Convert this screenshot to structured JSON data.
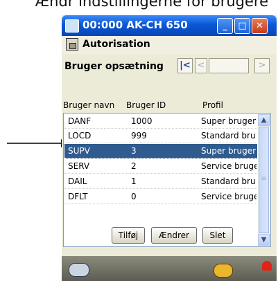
{
  "caption": "Ændr indstillingerne for brugere",
  "window": {
    "title": "00:000 AK-CH 650",
    "minimize_glyph": "_",
    "maximize_glyph": "□",
    "close_glyph": "✕"
  },
  "section": {
    "title": "Autorisation"
  },
  "user_setup": {
    "title": "Bruger opsætning",
    "nav_first": "|<",
    "nav_prev": "<",
    "nav_value": "",
    "nav_next": ">"
  },
  "columns": [
    "Bruger navn",
    "Bruger ID",
    "Profil"
  ],
  "rows": [
    {
      "name": "DANF",
      "id": "1000",
      "profile": "Super bruger"
    },
    {
      "name": "LOCD",
      "id": "999",
      "profile": "Standard bru"
    },
    {
      "name": "SUPV",
      "id": "3",
      "profile": "Super bruger"
    },
    {
      "name": "SERV",
      "id": "2",
      "profile": "Service bruge"
    },
    {
      "name": "DAIL",
      "id": "1",
      "profile": "Standard bru"
    },
    {
      "name": "DFLT",
      "id": "0",
      "profile": "Service bruge"
    }
  ],
  "selected_row_index": 2,
  "scrollbar": {
    "up": "▲",
    "down": "▼",
    "grip": "≡"
  },
  "buttons": {
    "add": "Tilføj",
    "change": "Ændrer",
    "delete": "Slet"
  },
  "icons": {
    "app": "monitor-icon",
    "lock": "lock-icon",
    "status_left": "glasses-icon",
    "status_key": "key-icon",
    "status_alarm": "bell-icon"
  },
  "colors": {
    "title_bar": "#0a57d6",
    "selection": "#2f5b8e",
    "alarm": "#e2231a"
  }
}
